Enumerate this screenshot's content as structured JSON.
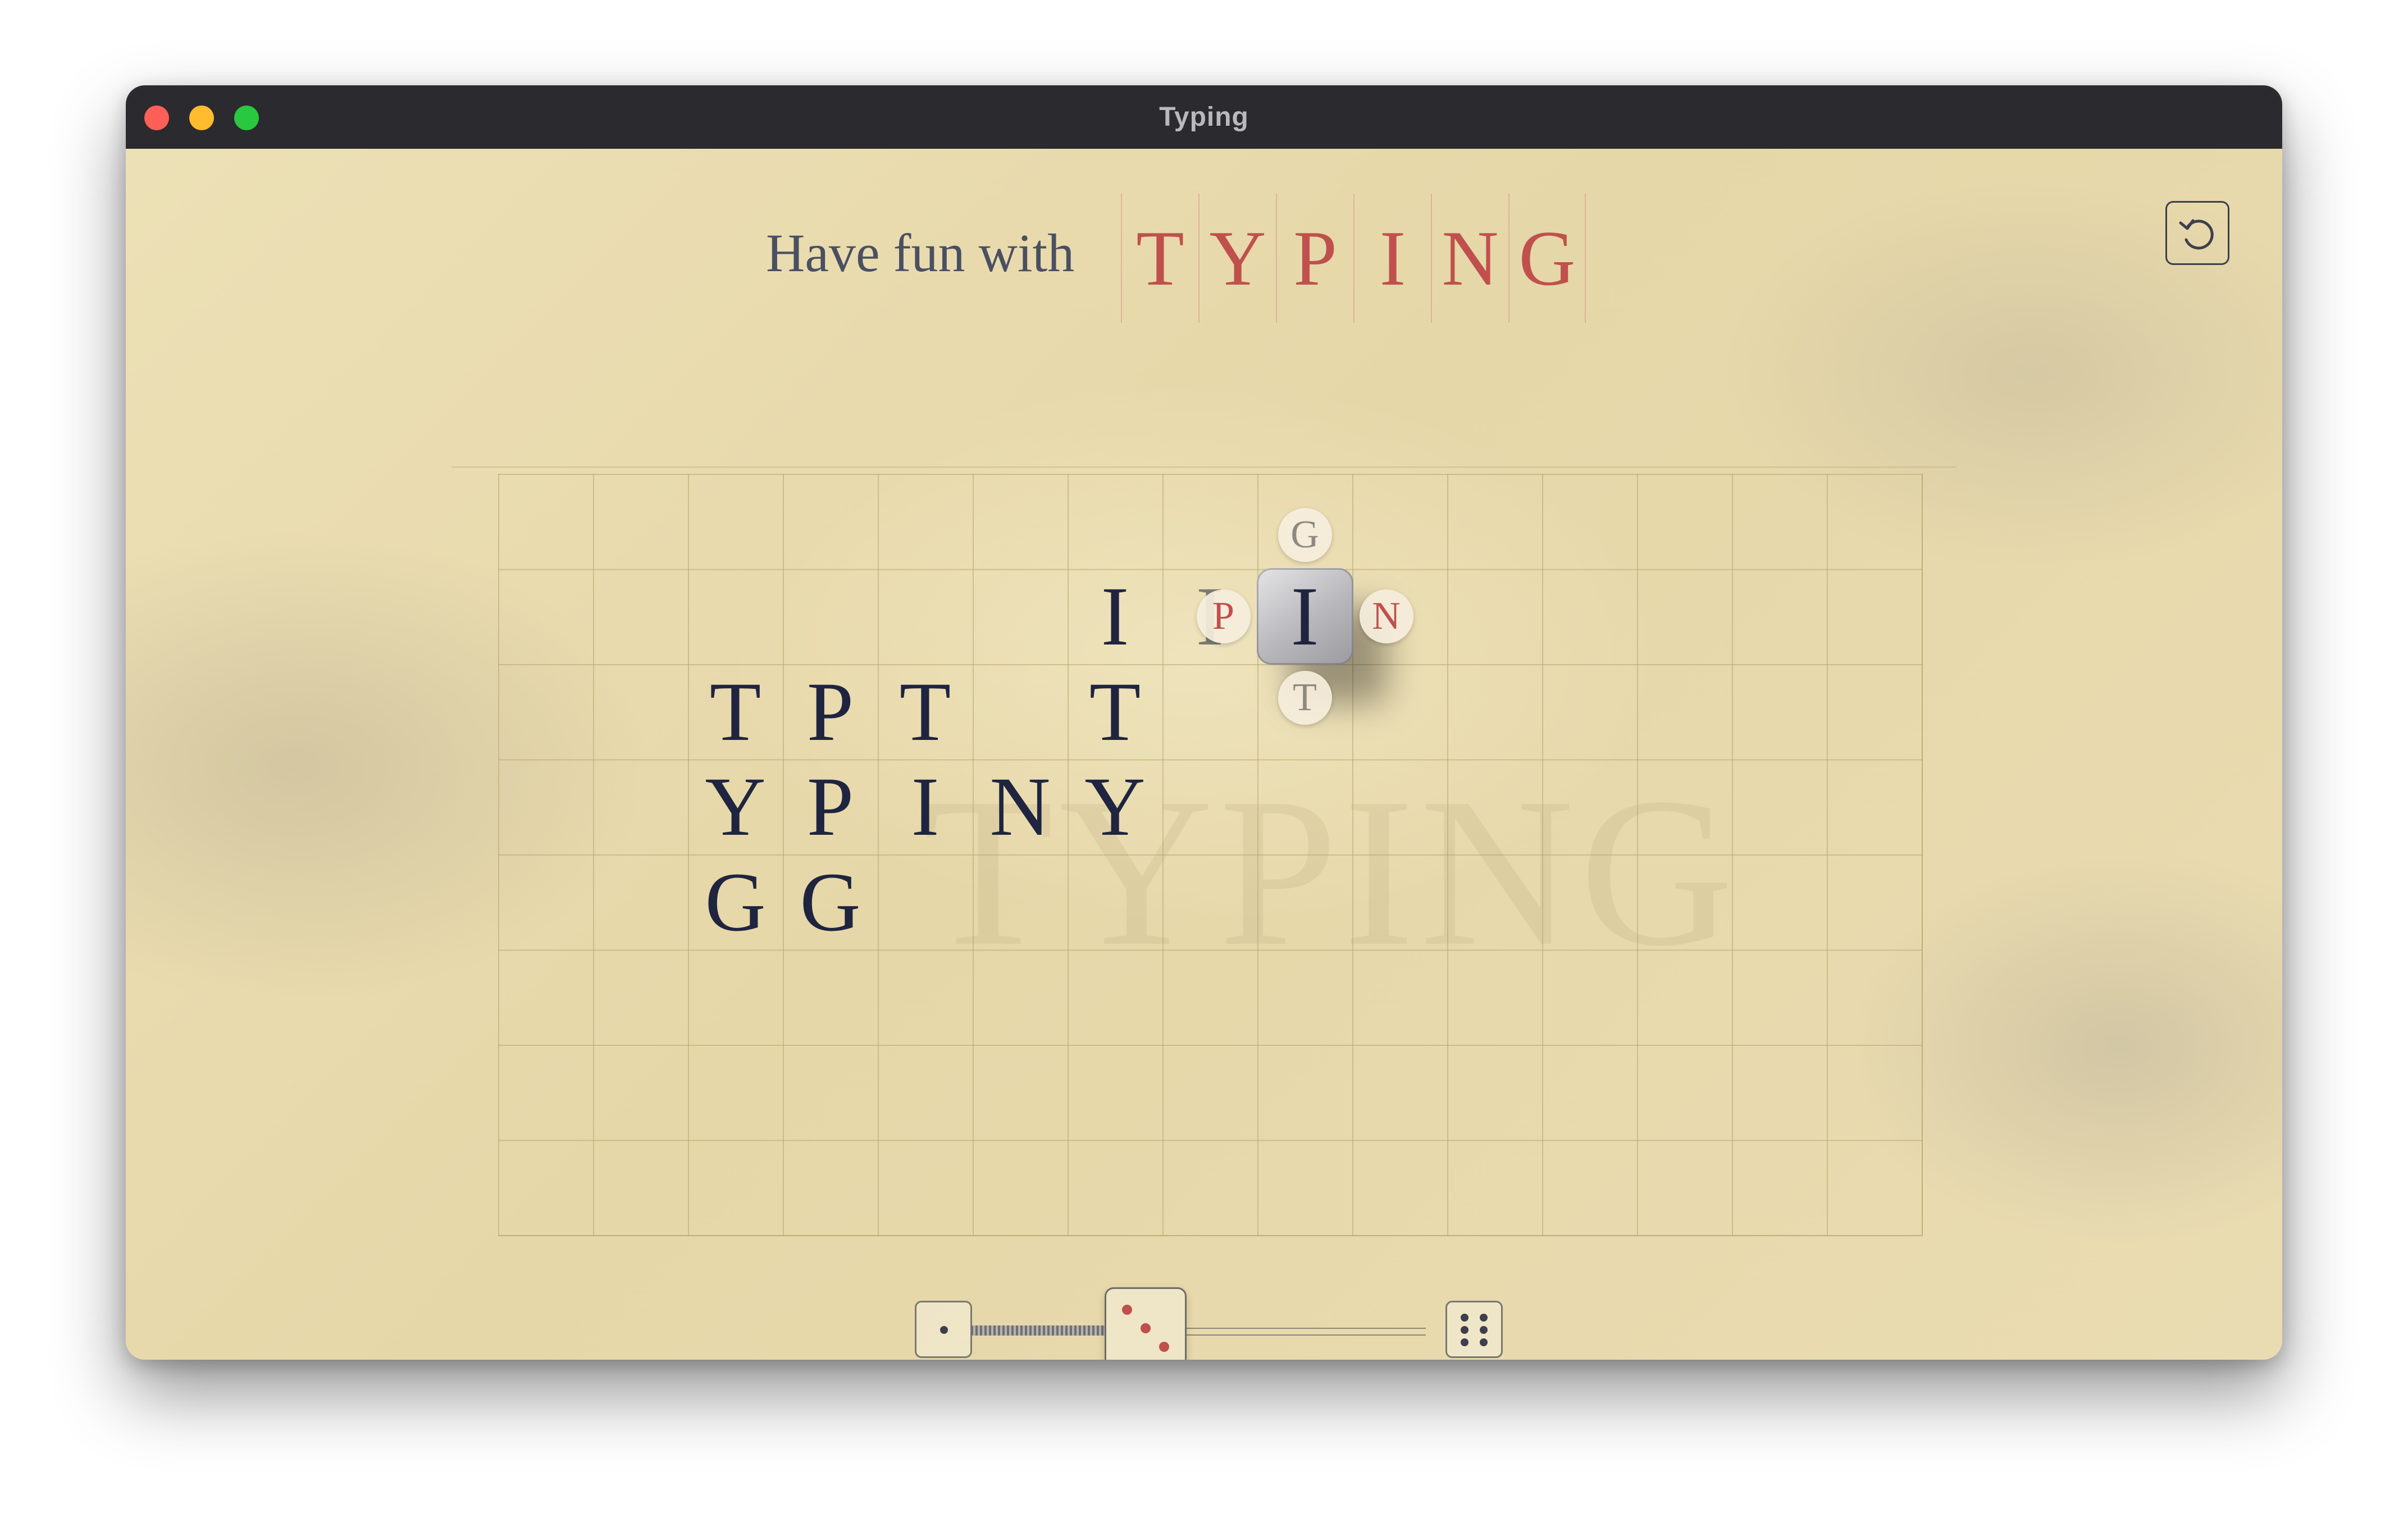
{
  "window": {
    "title": "Typing"
  },
  "header": {
    "prefix": "Have fun with",
    "word_letters": [
      "T",
      "Y",
      "P",
      "I",
      "N",
      "G"
    ]
  },
  "watermark": "TYPING",
  "board": {
    "placed_letters": [
      {
        "letter": "I",
        "row": 1,
        "col": 6
      },
      {
        "letter": "T",
        "row": 2,
        "col": 2
      },
      {
        "letter": "P",
        "row": 2,
        "col": 3
      },
      {
        "letter": "T",
        "row": 2,
        "col": 4
      },
      {
        "letter": "T",
        "row": 2,
        "col": 6
      },
      {
        "letter": "Y",
        "row": 3,
        "col": 2
      },
      {
        "letter": "P",
        "row": 3,
        "col": 3
      },
      {
        "letter": "I",
        "row": 3,
        "col": 4
      },
      {
        "letter": "N",
        "row": 3,
        "col": 5
      },
      {
        "letter": "Y",
        "row": 3,
        "col": 6
      },
      {
        "letter": "G",
        "row": 4,
        "col": 2
      },
      {
        "letter": "G",
        "row": 4,
        "col": 3
      }
    ],
    "ghost_letter": {
      "letter": "I",
      "row": 1,
      "col": 7
    },
    "active_die": {
      "letter": "I",
      "row": 1,
      "col": 8,
      "options": {
        "up": "G",
        "left": "P",
        "right": "N",
        "down": "T"
      }
    }
  },
  "dice_slider": {
    "min_face": 1,
    "current_face": 3,
    "max_face": 6
  }
}
